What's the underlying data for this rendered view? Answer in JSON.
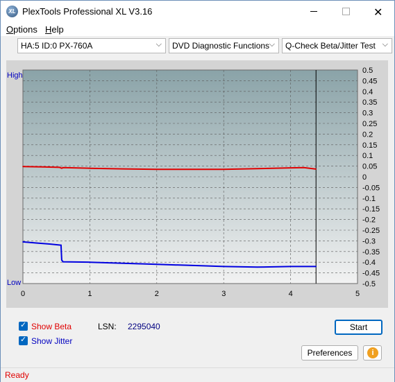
{
  "window": {
    "title": "PlexTools Professional XL V3.16",
    "icon_text": "XL"
  },
  "menu": {
    "options_label": "Options",
    "options_mnemonic": "O",
    "options_rest": "ptions",
    "help_label": "Help",
    "help_mnemonic": "H",
    "help_rest": "elp"
  },
  "toolbar": {
    "drive_select": "HA:5 ID:0  PX-760A",
    "function_select": "DVD Diagnostic Functions",
    "test_select": "Q-Check Beta/Jitter Test"
  },
  "chart_data": {
    "type": "line",
    "x_ticks": [
      "0",
      "1",
      "2",
      "3",
      "4",
      "5"
    ],
    "xlim": [
      0,
      5
    ],
    "y_right_ticks": [
      "0.5",
      "0.45",
      "0.4",
      "0.35",
      "0.3",
      "0.25",
      "0.2",
      "0.15",
      "0.1",
      "0.05",
      "0",
      "-0.05",
      "-0.1",
      "-0.15",
      "-0.2",
      "-0.25",
      "-0.3",
      "-0.35",
      "-0.4",
      "-0.45",
      "-0.5"
    ],
    "ylim": [
      -0.5,
      0.5
    ],
    "left_high_label": "High",
    "left_low_label": "Low",
    "end_marker_x": 4.38,
    "series": [
      {
        "name": "Beta",
        "color": "#e00000",
        "x": [
          0,
          0.3,
          0.55,
          0.58,
          0.6,
          1.0,
          1.5,
          2.0,
          2.5,
          3.0,
          3.5,
          4.0,
          4.2,
          4.38
        ],
        "values": [
          0.048,
          0.046,
          0.044,
          0.04,
          0.043,
          0.04,
          0.037,
          0.035,
          0.035,
          0.035,
          0.038,
          0.042,
          0.043,
          0.036
        ]
      },
      {
        "name": "Jitter",
        "color": "#0000e0",
        "x": [
          0,
          0.2,
          0.4,
          0.57,
          0.58,
          0.6,
          1.0,
          1.5,
          2.0,
          2.5,
          3.0,
          3.5,
          4.0,
          4.38
        ],
        "values": [
          -0.305,
          -0.31,
          -0.315,
          -0.32,
          -0.39,
          -0.398,
          -0.4,
          -0.405,
          -0.41,
          -0.415,
          -0.42,
          -0.423,
          -0.42,
          -0.42
        ]
      }
    ]
  },
  "controls": {
    "show_beta_label": "Show Beta",
    "show_jitter_label": "Show Jitter",
    "lsn_label": "LSN:",
    "lsn_value": "2295040",
    "start_label": "Start",
    "preferences_label": "Preferences",
    "info_icon": "i"
  },
  "status": {
    "text": "Ready"
  },
  "colors": {
    "beta_label": "#e00000",
    "jitter_label": "#0000c0"
  }
}
